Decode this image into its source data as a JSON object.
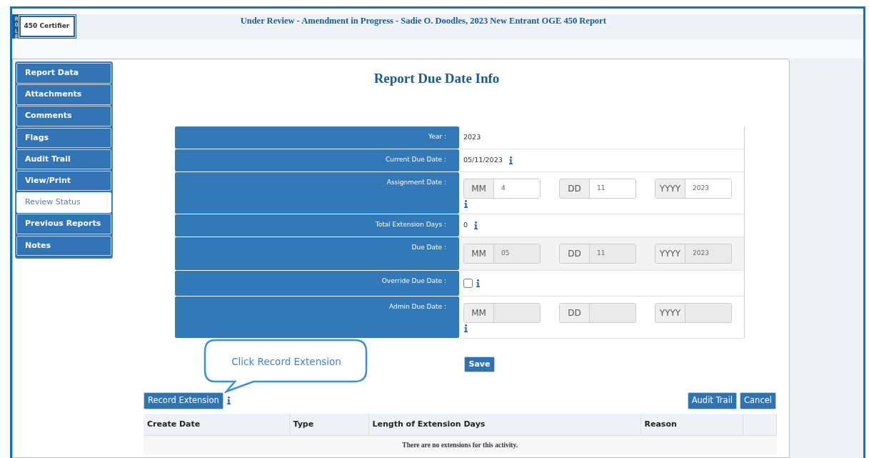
{
  "header": {
    "role_label": "ROLE",
    "role": "450 Certifier",
    "title": "Under Review - Amendment in Progress - Sadie O. Doodles, 2023 New Entrant OGE 450 Report"
  },
  "sidebar": {
    "items": [
      {
        "label": "Report Data",
        "selected": false
      },
      {
        "label": "Attachments",
        "selected": false
      },
      {
        "label": "Comments",
        "selected": false
      },
      {
        "label": "Flags",
        "selected": false
      },
      {
        "label": "Audit Trail",
        "selected": false
      },
      {
        "label": "View/Print",
        "selected": false
      },
      {
        "label": "Review Status",
        "selected": true
      },
      {
        "label": "Previous Reports",
        "selected": false
      },
      {
        "label": "Notes",
        "selected": false
      }
    ]
  },
  "page_title": "Report Due Date Info",
  "form": {
    "rows": [
      {
        "label": "Year :",
        "kind": "text",
        "value": "2023",
        "info": false,
        "shaded": false
      },
      {
        "label": "Current Due Date :",
        "kind": "text",
        "value": "05/11/2023",
        "info": true,
        "shaded": false
      },
      {
        "label": "Assignment Date :",
        "kind": "date",
        "disabled": false,
        "info": true,
        "shaded": false,
        "parts": [
          {
            "prefix": "MM",
            "value": "4"
          },
          {
            "prefix": "DD",
            "value": "11"
          },
          {
            "prefix": "YYYY",
            "value": "2023"
          }
        ]
      },
      {
        "label": "Total Extension Days :",
        "kind": "text",
        "value": "0",
        "info": true,
        "shaded": false
      },
      {
        "label": "Due Date :",
        "kind": "date",
        "disabled": true,
        "info": false,
        "shaded": true,
        "parts": [
          {
            "prefix": "MM",
            "value": "05"
          },
          {
            "prefix": "DD",
            "value": "11"
          },
          {
            "prefix": "YYYY",
            "value": "2023"
          }
        ]
      },
      {
        "label": "Override Due Date :",
        "kind": "checkbox",
        "checked": false,
        "info": true,
        "shaded": false
      },
      {
        "label": "Admin Due Date :",
        "kind": "date",
        "disabled": true,
        "info": true,
        "shaded": false,
        "parts": [
          {
            "prefix": "MM"
          },
          {
            "prefix": "DD"
          },
          {
            "prefix": "YYYY"
          }
        ]
      }
    ]
  },
  "save_button": "Save",
  "callout": "Click Record Extension",
  "extensions": {
    "record_button": "Record Extension",
    "info": true,
    "actions": [
      "Audit Trail",
      "Cancel"
    ],
    "table": {
      "columns": [
        "Create Date",
        "Type",
        "Length of Extension Days",
        "Reason"
      ],
      "empty_message": "There are no extensions for this activity."
    }
  }
}
